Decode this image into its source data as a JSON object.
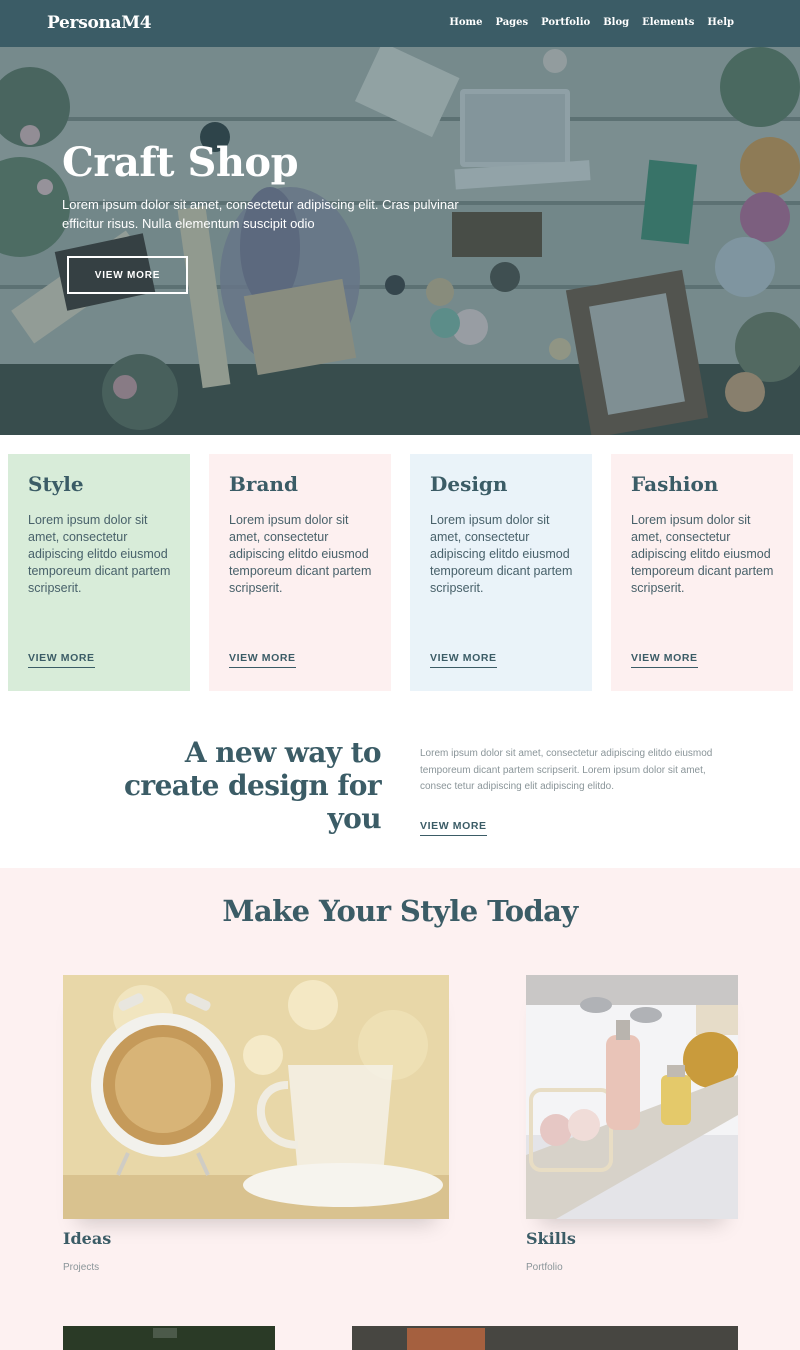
{
  "nav": {
    "brand": "PersonaM4",
    "links": [
      "Home",
      "Pages",
      "Portfolio",
      "Blog",
      "Elements",
      "Help"
    ]
  },
  "hero": {
    "title": "Craft Shop",
    "text": "Lorem ipsum dolor sit amet, consectetur adipiscing elit. Cras pulvinar efficitur risus. Nulla elementum suscipit odio",
    "button_label": "VIEW MORE"
  },
  "cards": [
    {
      "title": "Style",
      "text": "Lorem ipsum dolor sit amet, consectetur adipiscing elitdo eiusmod temporeum dicant partem scripserit.",
      "link": "VIEW MORE",
      "bg": "#d8ecd9"
    },
    {
      "title": "Brand",
      "text": "Lorem ipsum dolor sit amet, consectetur adipiscing elitdo eiusmod temporeum dicant partem scripserit.",
      "link": "VIEW MORE",
      "bg": "#fdf0f0"
    },
    {
      "title": "Design",
      "text": "Lorem ipsum dolor sit amet, consectetur adipiscing elitdo eiusmod temporeum dicant partem scripserit.",
      "link": "VIEW MORE",
      "bg": "#eaf3f9"
    },
    {
      "title": "Fashion",
      "text": "Lorem ipsum dolor sit amet, consectetur adipiscing elitdo eiusmod temporeum dicant partem scripserit.",
      "link": "VIEW MORE",
      "bg": "#fdf0f0"
    }
  ],
  "feature": {
    "heading": "A new way to create design for you",
    "text": "Lorem ipsum dolor sit amet, consectetur adipiscing elitdo eiusmod temporeum dicant partem scripserit. Lorem ipsum dolor sit amet, consec tetur adipiscing elit adipiscing elitdo.",
    "link": "VIEW MORE"
  },
  "style_section": {
    "heading": "Make Your Style Today",
    "items": [
      {
        "title": "Ideas",
        "subtitle": "Projects",
        "image": "coffee-alarm-clock-photo"
      },
      {
        "title": "Skills",
        "subtitle": "Portfolio",
        "image": "bath-products-photo"
      }
    ]
  },
  "colors": {
    "primary": "#3b5c66",
    "nav_bg": "#3b5c66",
    "section_bg": "#fdf1f1",
    "muted_text": "#8a9599"
  }
}
